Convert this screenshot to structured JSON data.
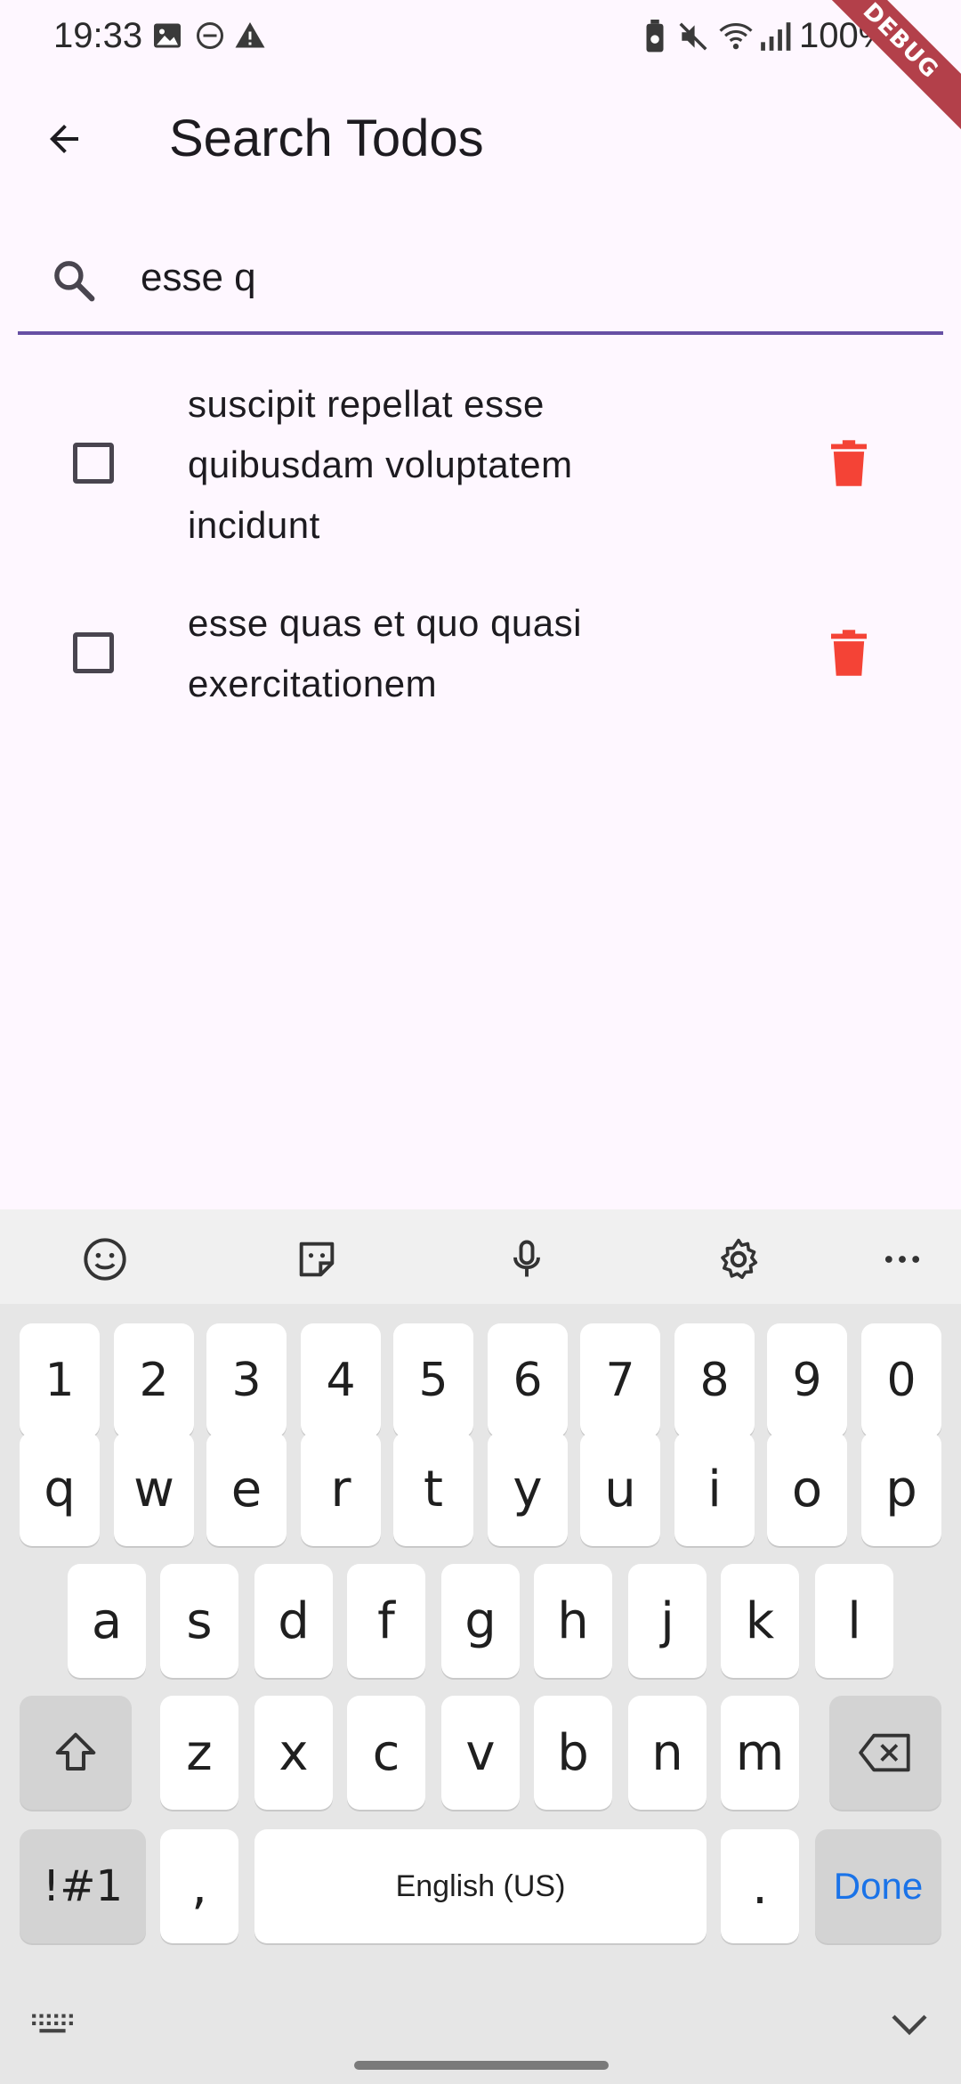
{
  "status_bar": {
    "time": "19:33",
    "battery": "100%",
    "debug_label": "DEBUG"
  },
  "app_bar": {
    "title": "Search Todos",
    "back_icon": "arrow-back-icon"
  },
  "search": {
    "value": "esse q",
    "icon": "search-icon",
    "accent_color": "#6750a4"
  },
  "todos": [
    {
      "text": "suscipit repellat esse quibusdam voluptatem incidunt",
      "completed": false
    },
    {
      "text": "esse quas et quo quasi exercitationem",
      "completed": false
    }
  ],
  "colors": {
    "background": "#fef7ff",
    "delete": "#f44336",
    "done_key": "#1a73e8"
  },
  "keyboard": {
    "toolbar_icons": [
      "emoji-icon",
      "sticker-icon",
      "mic-icon",
      "settings-icon",
      "more-icon"
    ],
    "number_row": [
      "1",
      "2",
      "3",
      "4",
      "5",
      "6",
      "7",
      "8",
      "9",
      "0"
    ],
    "row1": [
      "q",
      "w",
      "e",
      "r",
      "t",
      "y",
      "u",
      "i",
      "o",
      "p"
    ],
    "row2": [
      "a",
      "s",
      "d",
      "f",
      "g",
      "h",
      "j",
      "k",
      "l"
    ],
    "row3": [
      "z",
      "x",
      "c",
      "v",
      "b",
      "n",
      "m"
    ],
    "symbols_label": "!#1",
    "comma_label": ",",
    "space_label": "English (US)",
    "period_label": ".",
    "done_label": "Done"
  }
}
